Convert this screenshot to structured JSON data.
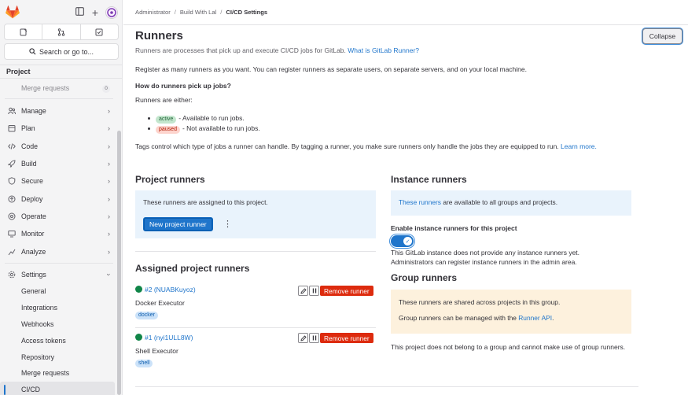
{
  "sidebar": {
    "search_label": "Search or go to...",
    "context_label": "Project",
    "faded_item": {
      "label": "Merge requests",
      "count": "0"
    },
    "items": [
      {
        "label": "Manage",
        "icon": "users-icon"
      },
      {
        "label": "Plan",
        "icon": "calendar-icon"
      },
      {
        "label": "Code",
        "icon": "code-icon"
      },
      {
        "label": "Build",
        "icon": "rocket-icon"
      },
      {
        "label": "Secure",
        "icon": "shield-icon"
      },
      {
        "label": "Deploy",
        "icon": "deploy-icon"
      },
      {
        "label": "Operate",
        "icon": "cloud-icon"
      },
      {
        "label": "Monitor",
        "icon": "monitor-icon"
      },
      {
        "label": "Analyze",
        "icon": "chart-icon"
      }
    ],
    "settings": {
      "label": "Settings",
      "sub": [
        "General",
        "Integrations",
        "Webhooks",
        "Access tokens",
        "Repository",
        "Merge requests",
        "CI/CD"
      ]
    }
  },
  "breadcrumb": {
    "items": [
      "Administrator",
      "Build With Lal",
      "CI/CD Settings"
    ]
  },
  "runners": {
    "title": "Runners",
    "collapse_label": "Collapse",
    "description": "Runners are processes that pick up and execute CI/CD jobs for GitLab.",
    "what_is_link": "What is GitLab Runner?",
    "register_text": "Register as many runners as you want. You can register runners as separate users, on separate servers, and on your local machine.",
    "how_heading": "How do runners pick up jobs?",
    "either_text": "Runners are either:",
    "active_pill": "active",
    "active_desc": "- Available to run jobs.",
    "paused_pill": "paused",
    "paused_desc": "- Not available to run jobs.",
    "tags_text": "Tags control which type of jobs a runner can handle. By tagging a runner, you make sure runners only handle the jobs they are equipped to run.",
    "learn_more": "Learn more."
  },
  "project_runners": {
    "title": "Project runners",
    "info": "These runners are assigned to this project.",
    "new_button": "New project runner",
    "assigned_title": "Assigned project runners",
    "list": [
      {
        "id": "#2 (NUABKuyoz)",
        "description": "Docker Executor",
        "tag": "docker",
        "remove_label": "Remove runner"
      },
      {
        "id": "#1 (nyi1ULL8W)",
        "description": "Shell Executor",
        "tag": "shell",
        "remove_label": "Remove runner"
      }
    ]
  },
  "instance_runners": {
    "title": "Instance runners",
    "info_link": "These runners",
    "info_rest": " are available to all groups and projects.",
    "toggle_label": "Enable instance runners for this project",
    "toggle_on": true,
    "note_line1": "This GitLab instance does not provide any instance runners yet.",
    "note_line2": "Administrators can register instance runners in the admin area."
  },
  "group_runners": {
    "title": "Group runners",
    "info1": "These runners are shared across projects in this group.",
    "info2_prefix": "Group runners can be managed with the ",
    "info2_link": "Runner API",
    "info2_suffix": ".",
    "note": "This project does not belong to a group and cannot make use of group runners."
  },
  "colors": {
    "accent": "#1f75cb",
    "danger": "#dd2b0e",
    "success": "#108548"
  }
}
